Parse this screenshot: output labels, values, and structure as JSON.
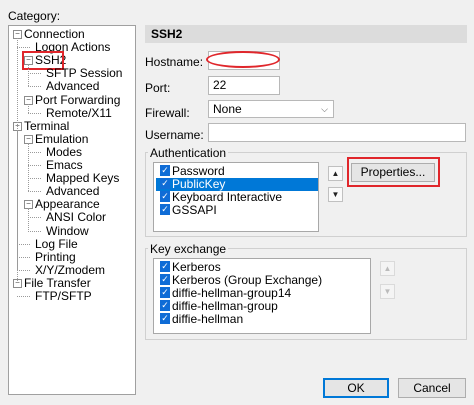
{
  "category_label": "Category:",
  "tree": [
    {
      "label": "Connection",
      "toggle": "−"
    },
    {
      "label": "Logon Actions"
    },
    {
      "label": "SSH2",
      "toggle": "−"
    },
    {
      "label": "SFTP Session"
    },
    {
      "label": "Advanced"
    },
    {
      "label": "Port Forwarding",
      "toggle": "−"
    },
    {
      "label": "Remote/X11"
    },
    {
      "label": "Terminal",
      "toggle": "−"
    },
    {
      "label": "Emulation",
      "toggle": "−"
    },
    {
      "label": "Modes"
    },
    {
      "label": "Emacs"
    },
    {
      "label": "Mapped Keys"
    },
    {
      "label": "Advanced"
    },
    {
      "label": "Appearance",
      "toggle": "−"
    },
    {
      "label": "ANSI Color"
    },
    {
      "label": "Window"
    },
    {
      "label": "Log File"
    },
    {
      "label": "Printing"
    },
    {
      "label": "X/Y/Zmodem"
    },
    {
      "label": "File Transfer",
      "toggle": "−"
    },
    {
      "label": "FTP/SFTP"
    }
  ],
  "panel": {
    "title": "SSH2",
    "hostname_label": "Hostname:",
    "hostname_value": "",
    "port_label": "Port:",
    "port_value": "22",
    "firewall_label": "Firewall:",
    "firewall_value": "None",
    "username_label": "Username:",
    "username_value": ""
  },
  "authentication": {
    "title": "Authentication",
    "items": [
      {
        "label": "Password",
        "checked": true
      },
      {
        "label": "PublicKey",
        "checked": true,
        "selected": true
      },
      {
        "label": "Keyboard Interactive",
        "checked": true
      },
      {
        "label": "GSSAPI",
        "checked": true
      }
    ],
    "up_arrow": "▲",
    "down_arrow": "▼",
    "properties_label": "Properties..."
  },
  "key_exchange": {
    "title": "Key exchange",
    "items": [
      {
        "label": "Kerberos",
        "checked": true
      },
      {
        "label": "Kerberos (Group Exchange)",
        "checked": true
      },
      {
        "label": "diffie-hellman-group14",
        "checked": true
      },
      {
        "label": "diffie-hellman-group",
        "checked": true
      },
      {
        "label": "diffie-hellman",
        "checked": true
      }
    ],
    "up_arrow": "▲",
    "down_arrow": "▼"
  },
  "footer": {
    "ok_label": "OK",
    "cancel_label": "Cancel"
  },
  "colors": {
    "highlight_red": "#e0262b",
    "selection_blue": "#0078d7"
  }
}
